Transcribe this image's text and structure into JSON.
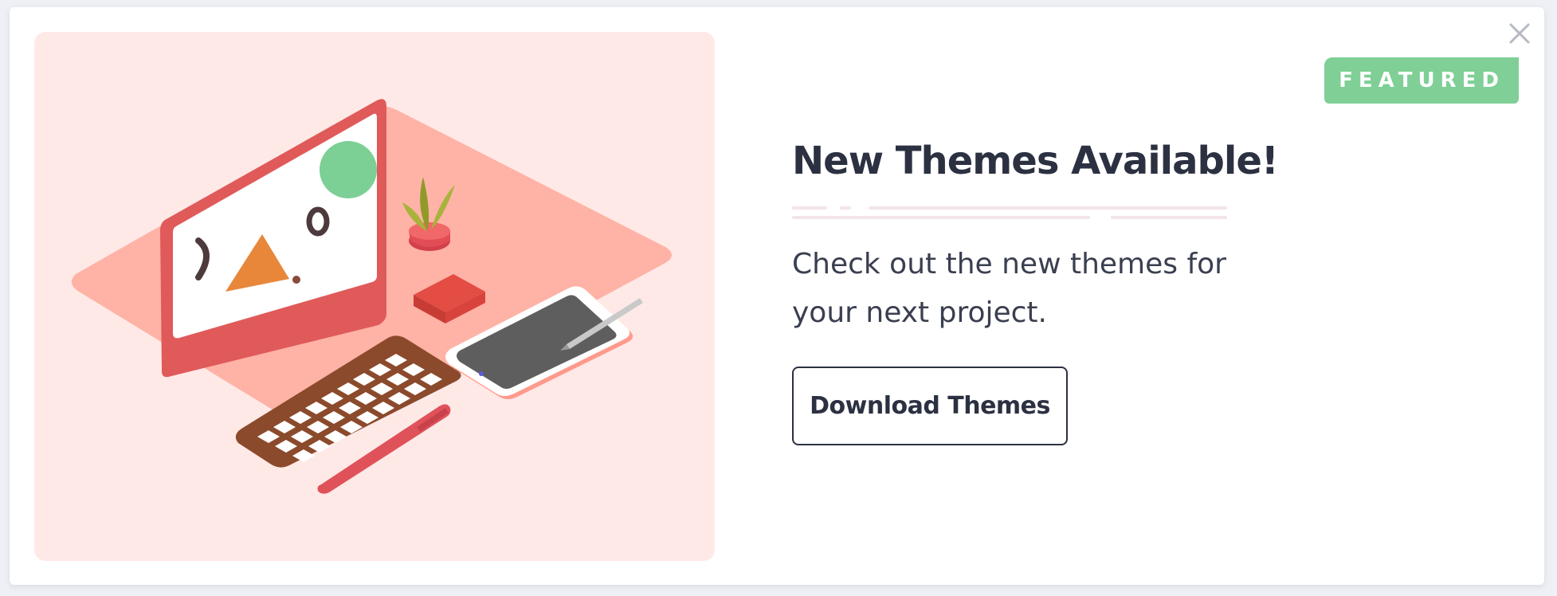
{
  "modal": {
    "badge": "FEATURED",
    "title": "New Themes Available!",
    "description": "Check out the new themes for your next project.",
    "cta_label": "Download Themes",
    "close_icon": "close-icon"
  },
  "colors": {
    "badge_bg": "#7fcf96",
    "illustration_bg": "#ffe9e7",
    "title": "#2c3142",
    "button_border": "#2c3142"
  },
  "illustration": {
    "icons": [
      "monitor-icon",
      "keyboard-icon",
      "tablet-icon",
      "pen-icon",
      "plant-icon",
      "box-icon"
    ]
  }
}
